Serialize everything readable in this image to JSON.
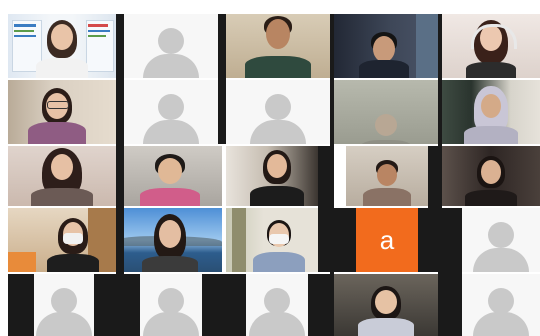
{
  "app": {
    "view": "gallery",
    "participants": 24
  },
  "tiles": [
    {
      "id": "r1c1",
      "kind": "video",
      "scene": "woman-poster-background"
    },
    {
      "id": "r1c2",
      "kind": "placeholder"
    },
    {
      "id": "r1c3",
      "kind": "video",
      "scene": "man-green-shirt"
    },
    {
      "id": "r1c4",
      "kind": "video",
      "scene": "dark-room-man"
    },
    {
      "id": "r1c5",
      "kind": "video",
      "scene": "woman-headset"
    },
    {
      "id": "r2c1",
      "kind": "video",
      "scene": "woman-glasses-purple"
    },
    {
      "id": "r2c2",
      "kind": "placeholder"
    },
    {
      "id": "r2c3",
      "kind": "placeholder"
    },
    {
      "id": "r2c4",
      "kind": "video",
      "scene": "dim-room-person"
    },
    {
      "id": "r2c5",
      "kind": "video",
      "scene": "woman-hijab"
    },
    {
      "id": "r3c1",
      "kind": "video",
      "scene": "woman-long-hair"
    },
    {
      "id": "r3c2",
      "kind": "video",
      "scene": "person-glasses-pink"
    },
    {
      "id": "r3c3",
      "kind": "video",
      "scene": "woman-black-top"
    },
    {
      "id": "r3c4",
      "kind": "video",
      "scene": "man-plaid"
    },
    {
      "id": "r3c5",
      "kind": "video",
      "scene": "woman-dark-room"
    },
    {
      "id": "r4c1",
      "kind": "video",
      "scene": "woman-mask-shelves"
    },
    {
      "id": "r4c2",
      "kind": "video",
      "scene": "woman-sky-background"
    },
    {
      "id": "r4c3",
      "kind": "video",
      "scene": "woman-mask-bookshelf"
    },
    {
      "id": "r4c4",
      "kind": "avatar",
      "letter": "a",
      "color": "#f26b1d"
    },
    {
      "id": "r4c5",
      "kind": "placeholder"
    },
    {
      "id": "r5c1",
      "kind": "placeholder"
    },
    {
      "id": "r5c2",
      "kind": "placeholder"
    },
    {
      "id": "r5c3",
      "kind": "placeholder"
    },
    {
      "id": "r5c4",
      "kind": "video",
      "scene": "woman-dim-room"
    },
    {
      "id": "r5c5",
      "kind": "placeholder"
    }
  ],
  "colors": {
    "placeholder_bg": "#f7f7f7",
    "placeholder_fg": "#c9c9c9",
    "avatar_orange": "#f26b1d",
    "separator": "#1a1a1a"
  }
}
